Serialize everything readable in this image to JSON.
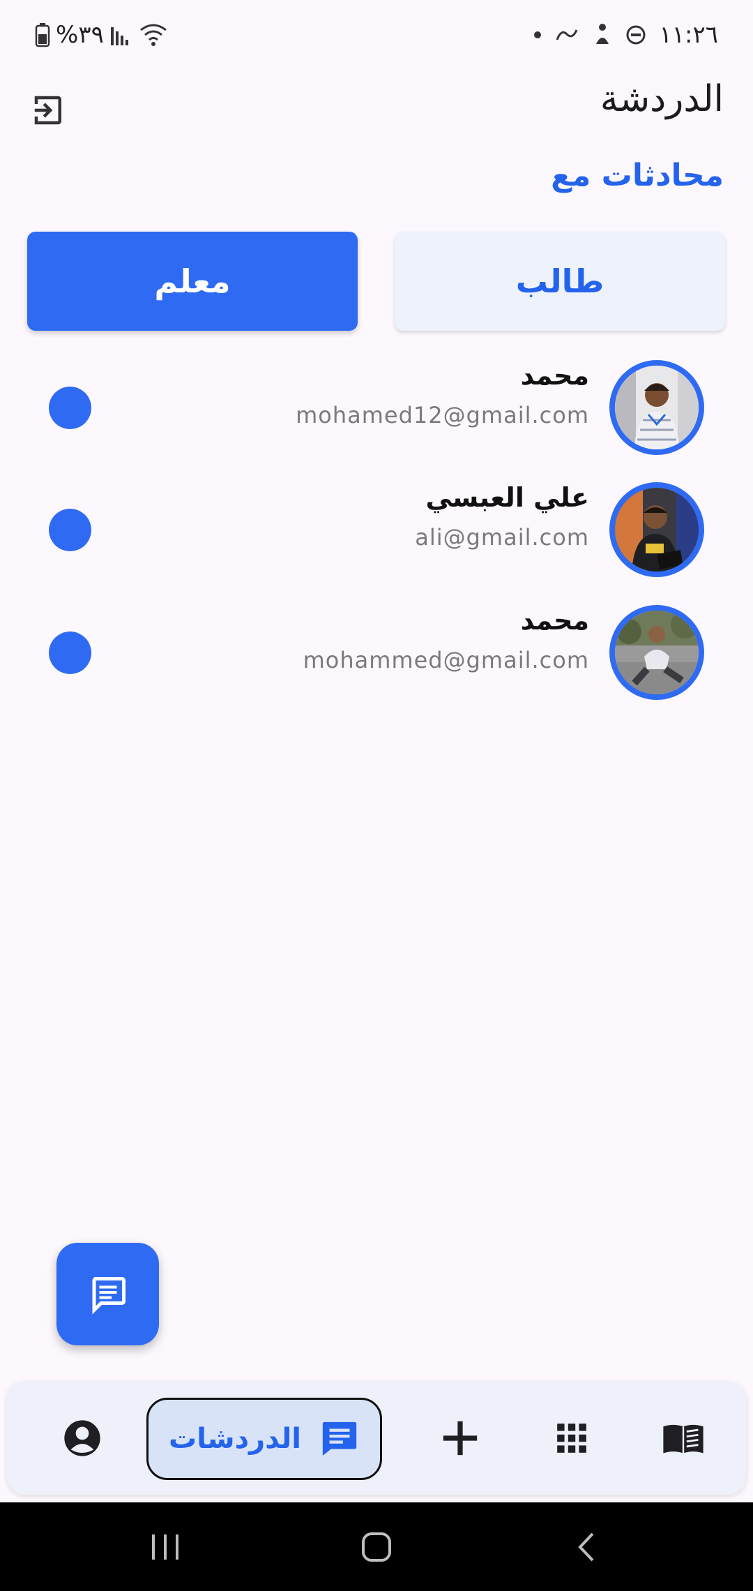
{
  "status_bar": {
    "time": "١١:٢٦",
    "battery_percent": "%٣٩",
    "icons": [
      "dot-icon",
      "link-icon",
      "accessibility-icon",
      "dnd-icon",
      "battery-icon",
      "signal-icon",
      "wifi-icon"
    ]
  },
  "header": {
    "title": "الدردشة",
    "logout_icon": "logout-icon"
  },
  "section_label": "محادثات مع",
  "toggle": {
    "teacher_label": "معلم",
    "student_label": "طالب",
    "selected": "teacher"
  },
  "contacts": [
    {
      "name": "محمد",
      "email": "mohamed12@gmail.com"
    },
    {
      "name": "علي العبسي",
      "email": "ali@gmail.com"
    },
    {
      "name": "محمد",
      "email": "mohammed@gmail.com"
    }
  ],
  "fab_icon": "message-icon",
  "bottom_nav": {
    "active_label": "الدردشات",
    "items": [
      "profile-icon",
      "chats-icon",
      "add-icon",
      "apps-grid-icon",
      "book-icon"
    ]
  },
  "colors": {
    "accent": "#2F6BF2",
    "accent_text": "#2463EB",
    "background": "#FCF8FD",
    "nav_bg": "#EEF1F9"
  }
}
